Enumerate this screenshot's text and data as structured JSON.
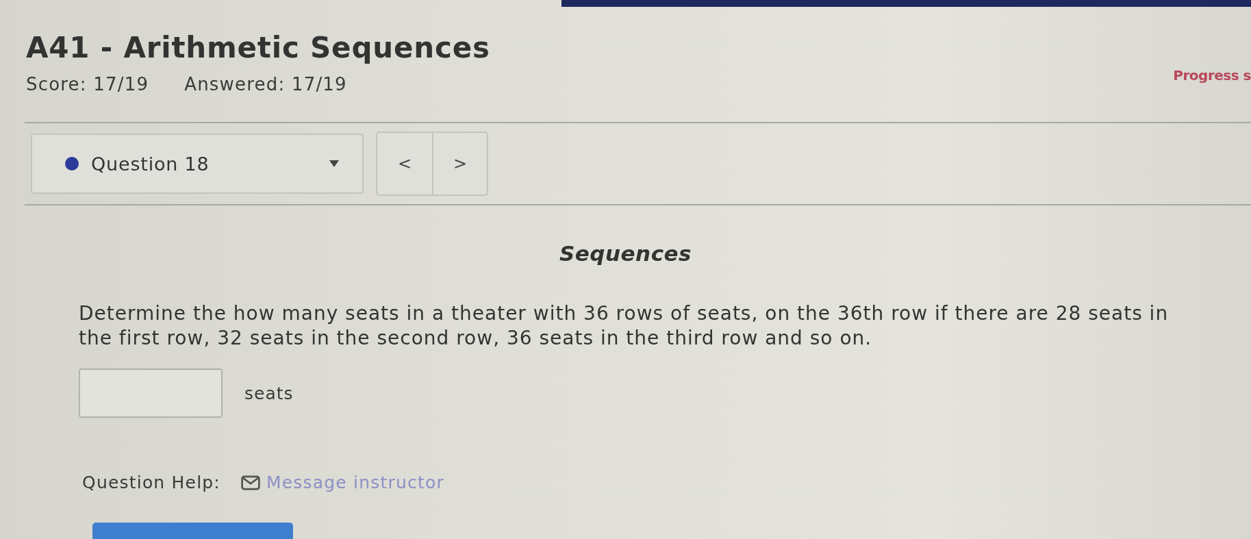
{
  "header": {
    "title": "A41 - Arithmetic Sequences",
    "score": "Score: 17/19",
    "answered": "Answered: 17/19",
    "progress": "Progress s"
  },
  "question_nav": {
    "selector": {
      "label": "Question 18"
    },
    "prev": "<",
    "next": ">"
  },
  "question": {
    "heading": "Sequences",
    "text": "Determine the how many seats in a theater with 36 rows of seats, on the 36th row if there are 28 seats in the first row, 32 seats in the second row, 36 seats in the third row and so on.",
    "answer": {
      "unit": "seats"
    }
  },
  "help": {
    "label": "Question Help:",
    "link": "Message instructor"
  }
}
